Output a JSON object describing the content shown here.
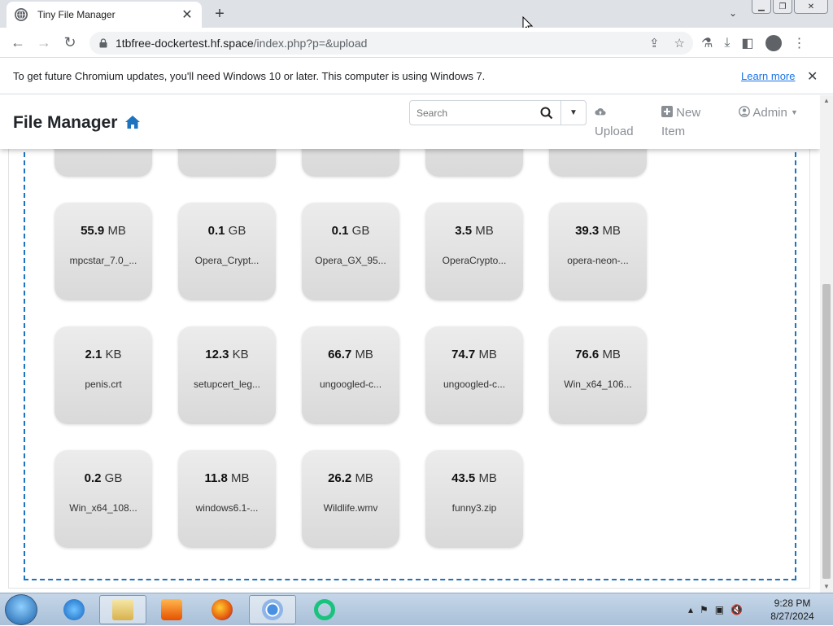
{
  "browser": {
    "tab_title": "Tiny File Manager",
    "url_host": "1tbfree-dockertest.hf.space",
    "url_path": "/index.php?p=&upload"
  },
  "infobar": {
    "message": "To get future Chromium updates, you'll need Windows 10 or later. This computer is using Windows 7.",
    "link": "Learn more"
  },
  "app": {
    "brand": "File Manager",
    "search_placeholder": "Search",
    "nav": {
      "upload": "Upload",
      "new_item": "New Item",
      "admin": "Admin"
    }
  },
  "files": [
    {
      "size": "55.9",
      "unit": "MB",
      "name": "mpcstar_7.0_..."
    },
    {
      "size": "0.1",
      "unit": "GB",
      "name": "Opera_Crypt..."
    },
    {
      "size": "0.1",
      "unit": "GB",
      "name": "Opera_GX_95..."
    },
    {
      "size": "3.5",
      "unit": "MB",
      "name": "OperaCrypto..."
    },
    {
      "size": "39.3",
      "unit": "MB",
      "name": "opera-neon-..."
    },
    {
      "size": "2.1",
      "unit": "KB",
      "name": "penis.crt"
    },
    {
      "size": "12.3",
      "unit": "KB",
      "name": "setupcert_leg..."
    },
    {
      "size": "66.7",
      "unit": "MB",
      "name": "ungoogled-c..."
    },
    {
      "size": "74.7",
      "unit": "MB",
      "name": "ungoogled-c..."
    },
    {
      "size": "76.6",
      "unit": "MB",
      "name": "Win_x64_106..."
    },
    {
      "size": "0.2",
      "unit": "GB",
      "name": "Win_x64_108..."
    },
    {
      "size": "11.8",
      "unit": "MB",
      "name": "windows6.1-..."
    },
    {
      "size": "26.2",
      "unit": "MB",
      "name": "Wildlife.wmv"
    },
    {
      "size": "43.5",
      "unit": "MB",
      "name": "funny3.zip"
    }
  ],
  "taskbar": {
    "time": "9:28 PM",
    "date": "8/27/2024"
  },
  "colors": {
    "dropzone_border": "#1e73be",
    "link": "#1a73e8",
    "home_icon": "#1e73be"
  }
}
